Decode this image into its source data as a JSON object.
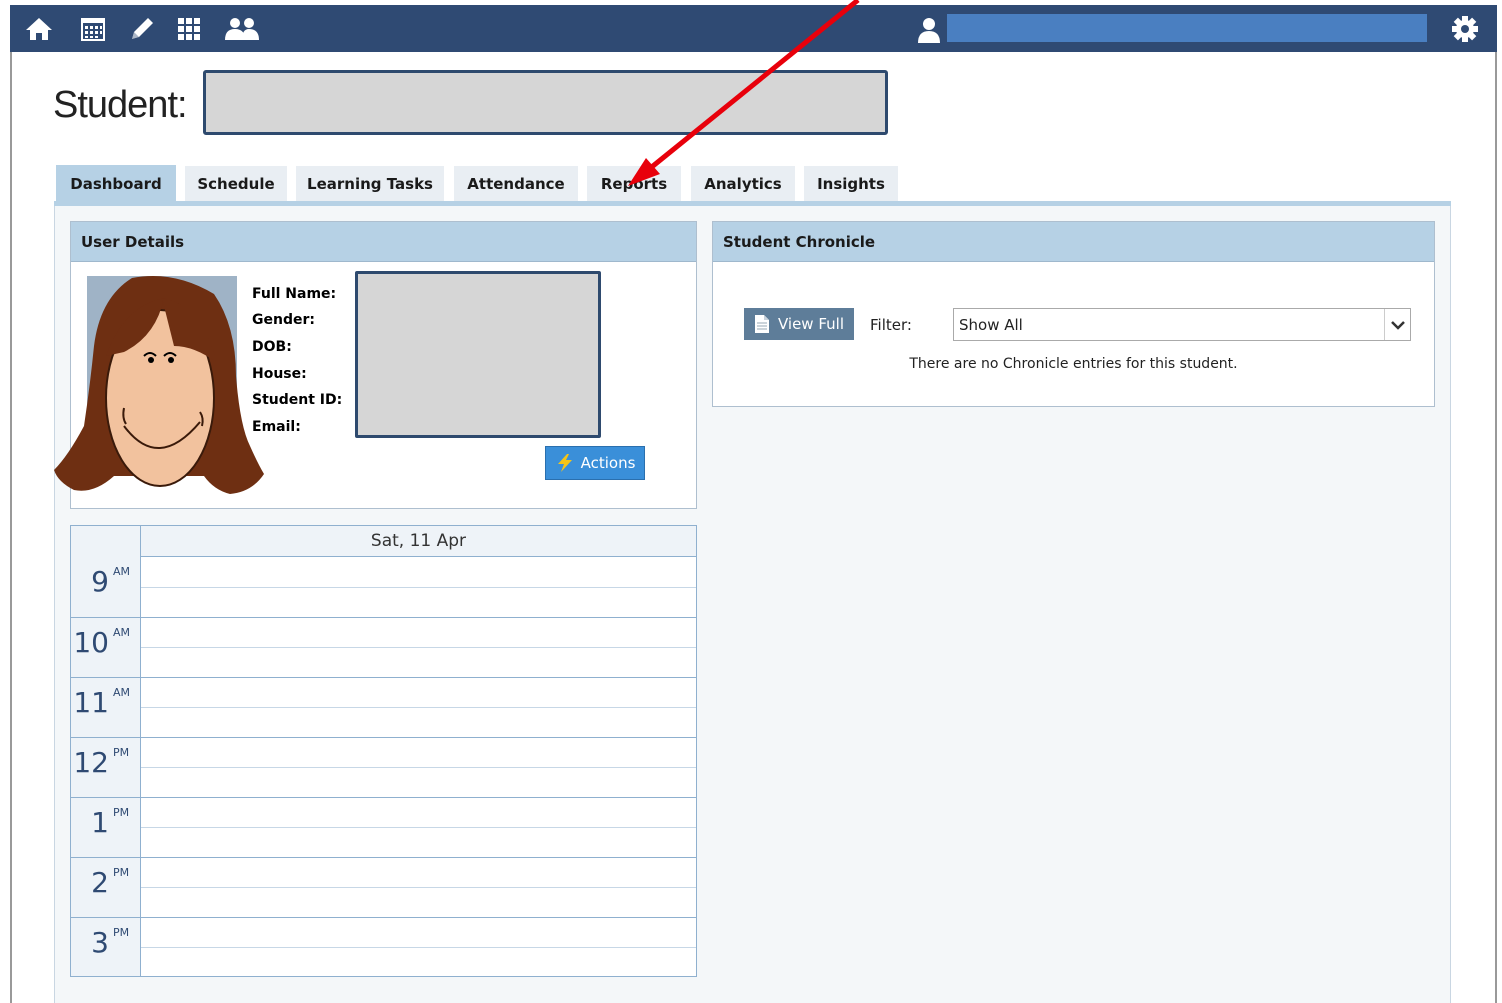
{
  "app": {
    "student_label": "Student:"
  },
  "icons": {
    "nav": [
      "home-icon",
      "calendar-icon",
      "pencil-icon",
      "grid-icon",
      "people-icon"
    ],
    "user": "user-icon",
    "settings": "gear-icon"
  },
  "colors": {
    "topbar": "#2f4a73",
    "tab_active": "#b6d1e5",
    "accent_button": "#3a8fd9"
  },
  "tabs": [
    {
      "label": "Dashboard",
      "active": true
    },
    {
      "label": "Schedule",
      "active": false
    },
    {
      "label": "Learning Tasks",
      "active": false
    },
    {
      "label": "Attendance",
      "active": false
    },
    {
      "label": "Reports",
      "active": false
    },
    {
      "label": "Analytics",
      "active": false
    },
    {
      "label": "Insights",
      "active": false
    }
  ],
  "user_details": {
    "title": "User Details",
    "fields": [
      "Full Name:",
      "Gender:",
      "DOB:",
      "House:",
      "Student ID:",
      "Email:"
    ],
    "actions_label": "Actions"
  },
  "chronicle": {
    "title": "Student Chronicle",
    "view_full_label": "View Full",
    "filter_label": "Filter:",
    "filter_value": "Show All",
    "empty_message": "There are no Chronicle entries for this student."
  },
  "calendar": {
    "day_label": "Sat, 11 Apr",
    "hours": [
      {
        "num": "9",
        "suffix": "AM"
      },
      {
        "num": "10",
        "suffix": "AM"
      },
      {
        "num": "11",
        "suffix": "AM"
      },
      {
        "num": "12",
        "suffix": "PM"
      },
      {
        "num": "1",
        "suffix": "PM"
      },
      {
        "num": "2",
        "suffix": "PM"
      },
      {
        "num": "3",
        "suffix": "PM"
      }
    ]
  }
}
